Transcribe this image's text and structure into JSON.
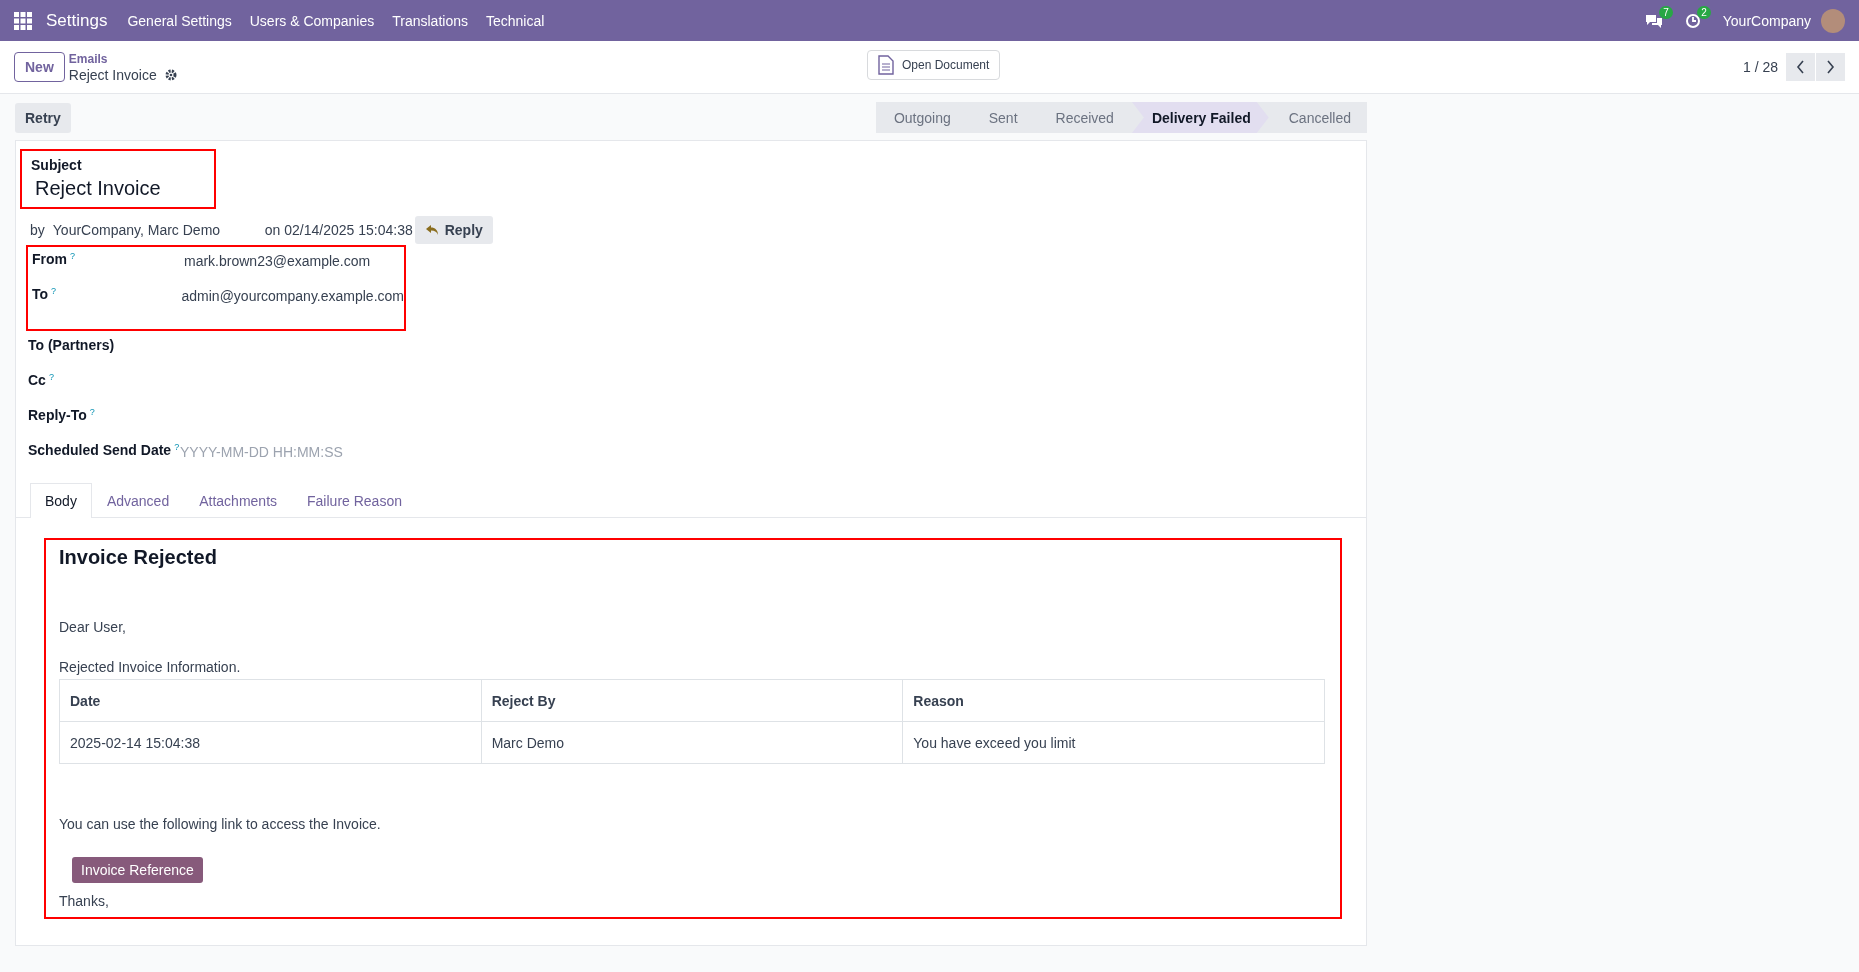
{
  "navbar": {
    "app": "Settings",
    "menus": [
      "General Settings",
      "Users & Companies",
      "Translations",
      "Technical"
    ],
    "chat_count": "7",
    "activity_count": "2",
    "company": "YourCompany"
  },
  "control_panel": {
    "new_button": "New",
    "breadcrumb": "Emails",
    "record": "Reject Invoice",
    "open_document": "Open Document",
    "pager": "1 / 28"
  },
  "action_buttons": [
    "Retry"
  ],
  "status_bar": [
    {
      "label": "Outgoing",
      "selected": false
    },
    {
      "label": "Sent",
      "selected": false
    },
    {
      "label": "Received",
      "selected": false
    },
    {
      "label": "Delivery Failed",
      "selected": true
    },
    {
      "label": "Cancelled",
      "selected": false
    }
  ],
  "subject": {
    "label": "Subject",
    "value": "Reject Invoice"
  },
  "author_line": {
    "by": "by",
    "authors": "YourCompany, Marc Demo",
    "date": "on 02/14/2025 15:04:38",
    "reply": "Reply"
  },
  "address_fields": [
    {
      "label": "From",
      "help": "?",
      "value": "mark.brown23@example.com"
    },
    {
      "label": "To",
      "help": "?",
      "value": "admin@yourcompany.example.com"
    }
  ],
  "other_fields": [
    {
      "label": "To (Partners)"
    },
    {
      "label": "Cc",
      "help": "?"
    },
    {
      "label": "Reply-To",
      "help": "?"
    },
    {
      "label": "Scheduled Send Date",
      "help": "?",
      "placeholder": "YYYY-MM-DD HH:MM:SS"
    }
  ],
  "tabs": [
    {
      "label": "Body",
      "selected": true
    },
    {
      "label": "Advanced",
      "selected": false
    },
    {
      "label": "Attachments",
      "selected": false
    },
    {
      "label": "Failure Reason",
      "selected": false
    }
  ],
  "body": {
    "title": "Invoice Rejected",
    "greeting": "Dear User,",
    "intro": "Rejected Invoice Information.",
    "table": {
      "columns": [
        "Date",
        "Reject By",
        "Reason"
      ],
      "rows": [
        [
          "2025-02-14 15:04:38",
          "Marc Demo",
          "You have exceed you limit"
        ]
      ]
    },
    "link_text": "You can use the following link to access the Invoice.",
    "button": "Invoice Reference",
    "closing": "Thanks,"
  }
}
